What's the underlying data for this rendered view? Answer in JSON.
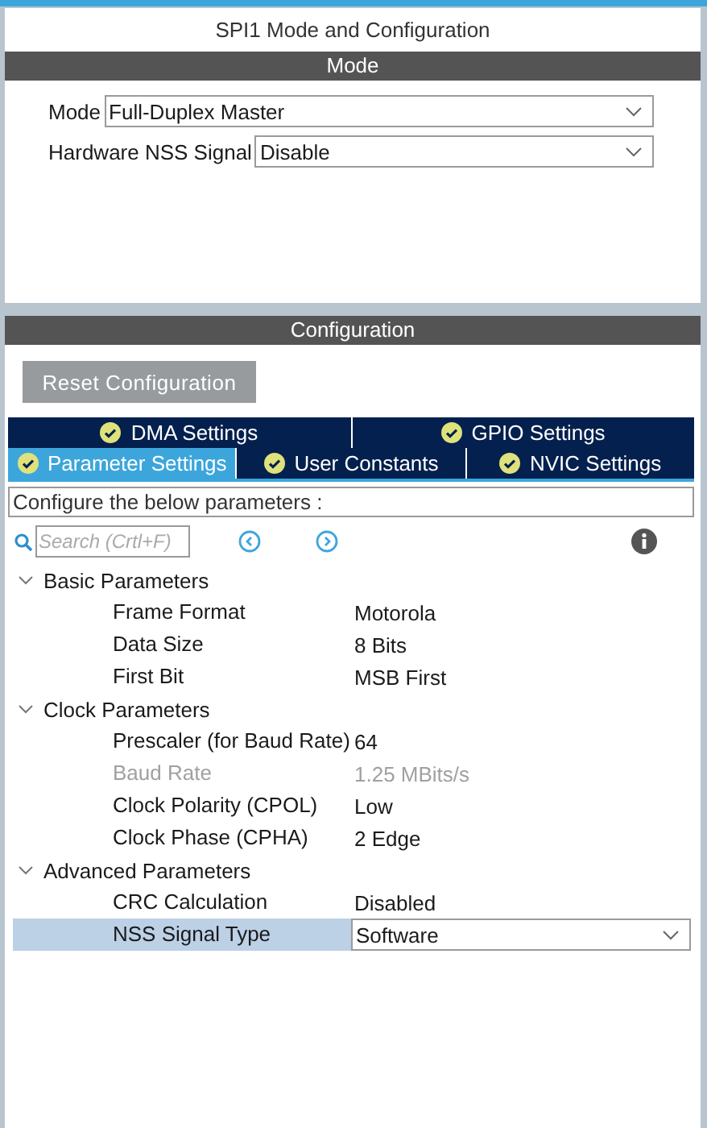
{
  "title": "SPI1 Mode and Configuration",
  "mode": {
    "header": "Mode",
    "fields": [
      {
        "label": "Mode",
        "value": "Full-Duplex Master"
      },
      {
        "label": "Hardware NSS Signal",
        "value": "Disable"
      }
    ]
  },
  "configuration": {
    "header": "Configuration",
    "reset_button": "Reset Configuration",
    "tab_rows": [
      [
        {
          "label": "DMA Settings",
          "selected": false
        },
        {
          "label": "GPIO Settings",
          "selected": false
        }
      ],
      [
        {
          "label": "Parameter Settings",
          "selected": true
        },
        {
          "label": "User Constants",
          "selected": false
        },
        {
          "label": "NVIC Settings",
          "selected": false
        }
      ]
    ],
    "hint": "Configure the below parameters :",
    "search": {
      "placeholder": "Search (Crtl+F)"
    },
    "groups": [
      {
        "label": "Basic Parameters",
        "expanded": true,
        "children": [
          {
            "label": "Frame Format",
            "value": "Motorola",
            "kind": "text",
            "disabled": false,
            "selected": false
          },
          {
            "label": "Data Size",
            "value": "8 Bits",
            "kind": "text",
            "disabled": false,
            "selected": false
          },
          {
            "label": "First Bit",
            "value": "MSB First",
            "kind": "text",
            "disabled": false,
            "selected": false
          }
        ]
      },
      {
        "label": "Clock Parameters",
        "expanded": true,
        "children": [
          {
            "label": "Prescaler (for Baud Rate)",
            "value": "64",
            "kind": "text",
            "disabled": false,
            "selected": false
          },
          {
            "label": "Baud Rate",
            "value": "1.25 MBits/s",
            "kind": "text",
            "disabled": true,
            "selected": false
          },
          {
            "label": "Clock Polarity (CPOL)",
            "value": "Low",
            "kind": "text",
            "disabled": false,
            "selected": false
          },
          {
            "label": "Clock Phase (CPHA)",
            "value": "2 Edge",
            "kind": "text",
            "disabled": false,
            "selected": false
          }
        ]
      },
      {
        "label": "Advanced Parameters",
        "expanded": true,
        "children": [
          {
            "label": "CRC Calculation",
            "value": "Disabled",
            "kind": "text",
            "disabled": false,
            "selected": false
          },
          {
            "label": "NSS Signal Type",
            "value": "Software",
            "kind": "dropdown",
            "disabled": false,
            "selected": true
          }
        ]
      }
    ]
  }
}
